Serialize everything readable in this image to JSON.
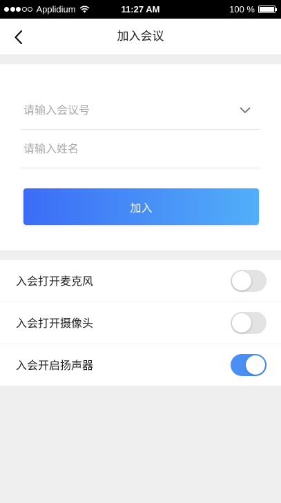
{
  "status_bar": {
    "carrier": "Applidium",
    "time": "11:27 AM",
    "battery": "100 %",
    "signal_bars": 5,
    "signal_filled": 3
  },
  "nav": {
    "title": "加入会议",
    "back_icon": "chevron-left-icon"
  },
  "form": {
    "meeting_id": {
      "value": "",
      "placeholder": "请输入会议号",
      "dropdown_icon": "chevron-down-icon"
    },
    "name": {
      "value": "",
      "placeholder": "请输入姓名"
    },
    "join_label": "加入"
  },
  "settings": [
    {
      "label": "入会打开麦克风",
      "enabled": false
    },
    {
      "label": "入会打开摄像头",
      "enabled": false
    },
    {
      "label": "入会开启扬声器",
      "enabled": true
    }
  ],
  "colors": {
    "accent_start": "#3b6cf6",
    "accent_end": "#52aff8",
    "toggle_on": "#4a8ff5",
    "toggle_off": "#e3e3e3",
    "background": "#efefef"
  }
}
